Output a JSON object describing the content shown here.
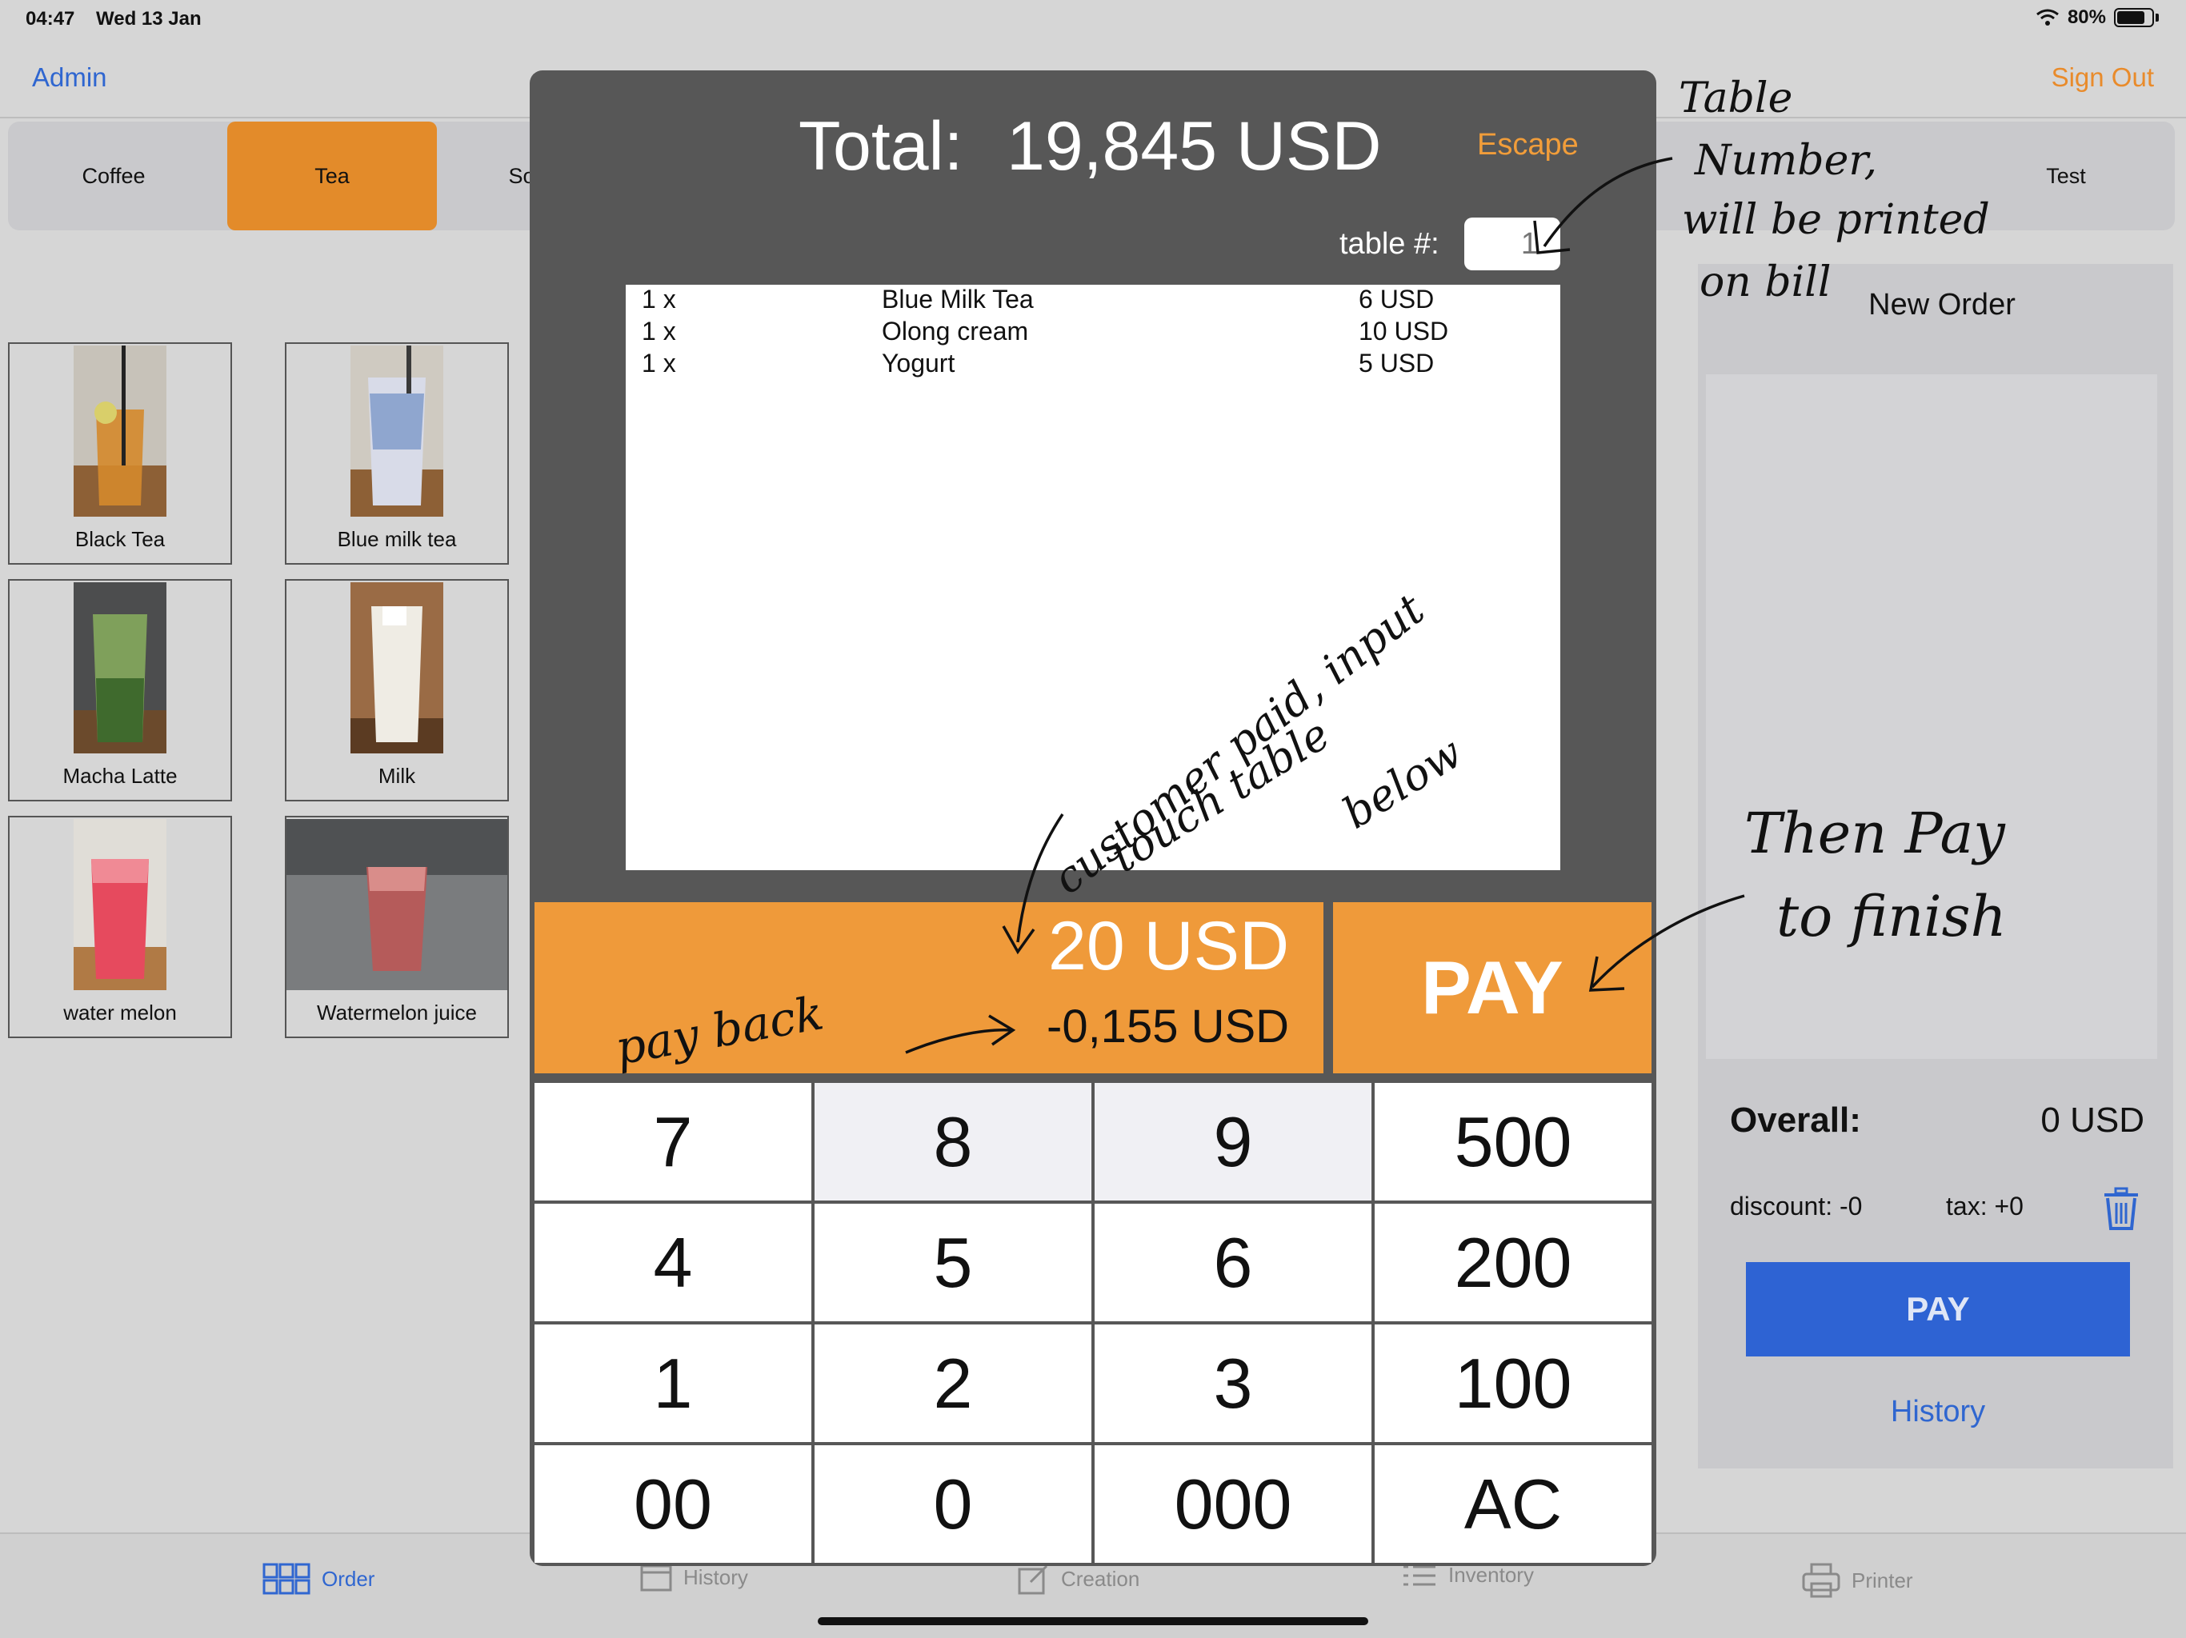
{
  "status": {
    "time": "04:47",
    "date": "Wed 13 Jan",
    "battery": "80%"
  },
  "nav": {
    "left": "Admin",
    "right": "Sign Out"
  },
  "categories": [
    "Coffee",
    "Tea",
    "Sof",
    "Test"
  ],
  "active_category": "Tea",
  "products": [
    "Black Tea",
    "Blue milk tea",
    "Macha Latte",
    "Milk",
    "water melon",
    "Watermelon juice"
  ],
  "order_panel": {
    "title": "New Order",
    "overall_label": "Overall:",
    "overall_value": "0 USD",
    "discount": "discount: -0",
    "tax": "tax: +0",
    "pay": "PAY",
    "history": "History"
  },
  "tabs": [
    "Order",
    "History",
    "Creation",
    "Inventory",
    "Printer"
  ],
  "modal": {
    "total_label": "Total:",
    "total_value": "19,845 USD",
    "escape": "Escape",
    "table_label": "table #:",
    "table_placeholder": "1",
    "bill": [
      {
        "qty": "1 x",
        "item": "Blue Milk Tea",
        "price": "6 USD"
      },
      {
        "qty": "1 x",
        "item": "Olong cream",
        "price": "10 USD"
      },
      {
        "qty": "1 x",
        "item": "Yogurt",
        "price": "5 USD"
      }
    ],
    "paid_amount": "20 USD",
    "pay_back": "-0,155 USD",
    "pay": "PAY",
    "keys": [
      "7",
      "8",
      "9",
      "500",
      "4",
      "5",
      "6",
      "200",
      "1",
      "2",
      "3",
      "100",
      "00",
      "0",
      "000",
      "AC"
    ]
  },
  "annotations": {
    "table": [
      "Table",
      "Number,",
      "will be printed",
      "on bill"
    ],
    "customer": [
      "customer paid, input",
      "touch table",
      "below"
    ],
    "pay_back": "pay back",
    "then_pay": [
      "Then Pay",
      "to finish"
    ]
  },
  "colors": {
    "accent_orange": "#ef9a3a",
    "modal_bg": "#575757",
    "blue": "#2e63d3",
    "link_blue": "#2f66d0"
  }
}
